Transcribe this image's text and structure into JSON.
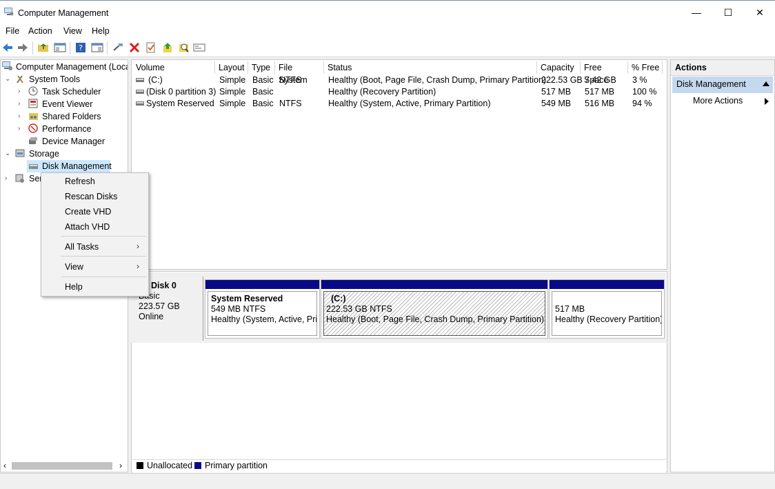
{
  "window": {
    "title": "Computer Management",
    "minimize": "—",
    "maximize": "☐",
    "close": "✕"
  },
  "menu": [
    "File",
    "Action",
    "View",
    "Help"
  ],
  "tree": {
    "root": "Computer Management (Local",
    "system_tools": "System Tools",
    "task_scheduler": "Task Scheduler",
    "event_viewer": "Event Viewer",
    "shared_folders": "Shared Folders",
    "performance": "Performance",
    "device_manager": "Device Manager",
    "storage": "Storage",
    "disk_management": "Disk Management",
    "services": "Ser"
  },
  "columns": [
    "Volume",
    "Layout",
    "Type",
    "File System",
    "Status",
    "Capacity",
    "Free Space",
    "% Free"
  ],
  "volumes": [
    {
      "volume": "(C:)",
      "layout": "Simple",
      "type": "Basic",
      "fs": "NTFS",
      "status": "Healthy (Boot, Page File, Crash Dump, Primary Partition)",
      "capacity": "222.53 GB",
      "free": "7.42 GB",
      "pct": "3 %"
    },
    {
      "volume": "(Disk 0 partition 3)",
      "layout": "Simple",
      "type": "Basic",
      "fs": "",
      "status": "Healthy (Recovery Partition)",
      "capacity": "517 MB",
      "free": "517 MB",
      "pct": "100 %"
    },
    {
      "volume": "System Reserved",
      "layout": "Simple",
      "type": "Basic",
      "fs": "NTFS",
      "status": "Healthy (System, Active, Primary Partition)",
      "capacity": "549 MB",
      "free": "516 MB",
      "pct": "94 %"
    }
  ],
  "disk": {
    "name": "Disk 0",
    "type": "Basic",
    "size": "223.57 GB",
    "state": "Online"
  },
  "partitions": [
    {
      "title": "System Reserved",
      "size": "549 MB NTFS",
      "status": "Healthy (System, Active, Prim"
    },
    {
      "title": "(C:)",
      "size": "222.53 GB NTFS",
      "status": "Healthy (Boot, Page File, Crash Dump, Primary Partition)"
    },
    {
      "title": "",
      "size": "517 MB",
      "status": "Healthy (Recovery Partition)"
    }
  ],
  "legend": {
    "unallocated": "Unallocated",
    "primary": "Primary partition"
  },
  "actions": {
    "header": "Actions",
    "section": "Disk Management",
    "more": "More Actions"
  },
  "context_menu": {
    "refresh": "Refresh",
    "rescan": "Rescan Disks",
    "create_vhd": "Create VHD",
    "attach_vhd": "Attach VHD",
    "all_tasks": "All Tasks",
    "view": "View",
    "help": "Help"
  },
  "colors": {
    "partition_bar": "#0a0a86",
    "selection": "#cce8ff",
    "actions_section": "#c4d9ee"
  }
}
